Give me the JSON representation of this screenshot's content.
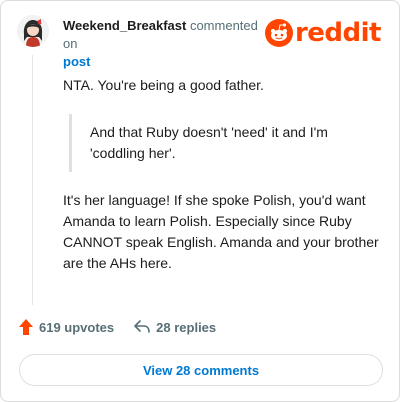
{
  "header": {
    "username": "Weekend_Breakfast",
    "action_text": "commented on",
    "post_link": "post"
  },
  "brand": {
    "name": "reddit",
    "color": "#ff4500",
    "icon": "reddit-snoo-icon"
  },
  "comment": {
    "paragraph1": "NTA. You're being a good father.",
    "quote": "And that Ruby doesn't 'need' it and I'm 'coddling her'.",
    "paragraph2": "It's her language! If she spoke Polish, you'd want Amanda to learn Polish. Especially since Ruby CANNOT speak English. Amanda and your brother are the AHs here."
  },
  "actions": {
    "upvotes": "619 upvotes",
    "upvote_icon": "upvote-arrow-icon",
    "replies": "28 replies",
    "reply_icon": "reply-arrow-icon"
  },
  "view_button": "View 28 comments",
  "colors": {
    "accent": "#0079d3",
    "upvote": "#ff4500",
    "muted": "#576f76"
  }
}
